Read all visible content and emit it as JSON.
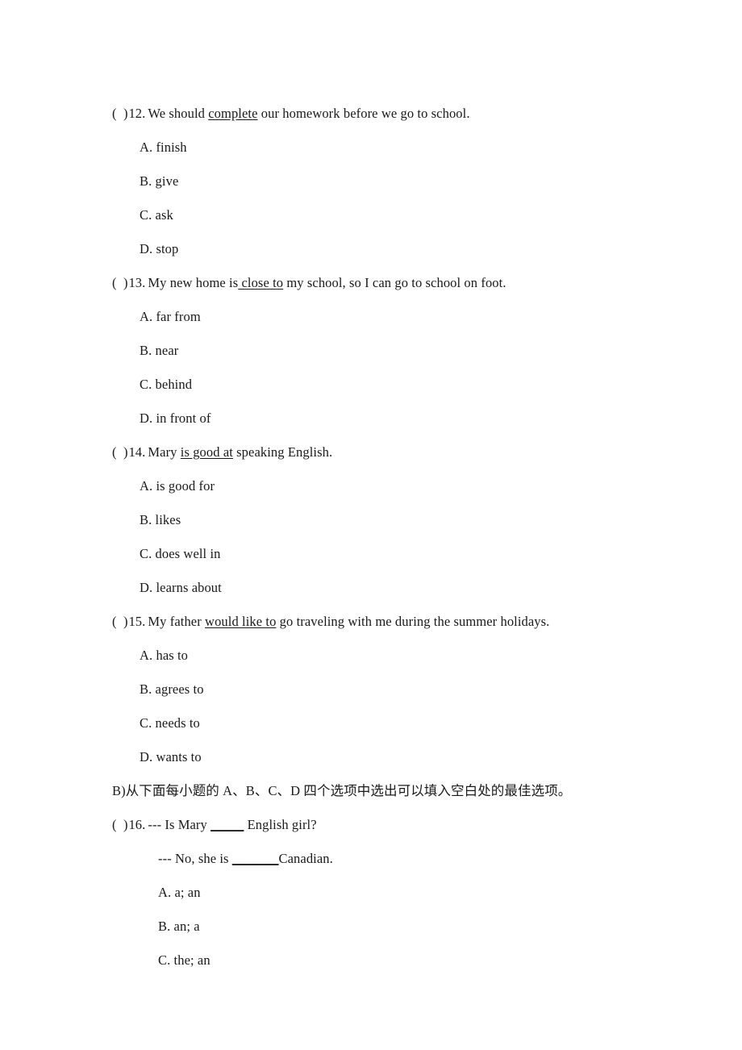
{
  "page": {
    "document_type": "english-exam-worksheet",
    "background_color": "#ffffff",
    "text_color": "#1a1a1a"
  },
  "questions": [
    {
      "marker": "(",
      "marker_close": ")",
      "number": "12.",
      "stem_before": "We should ",
      "stem_underlined": "complete",
      "stem_after": " our homework before we go to school.",
      "options": [
        "A. finish",
        "B. give",
        "C. ask",
        "D. stop"
      ]
    },
    {
      "marker": "(",
      "marker_close": ")",
      "number": "13.",
      "stem_before": "My new home is",
      "stem_underlined": " close to",
      "stem_after": " my school, so I can go to school on foot.",
      "options": [
        "A. far from",
        "B. near",
        "C. behind",
        "D. in front of"
      ]
    },
    {
      "marker": "(",
      "marker_close": ")",
      "number": "14.",
      "stem_before": "Mary ",
      "stem_underlined": "is good at",
      "stem_after": " speaking English.",
      "options": [
        "A. is good for",
        "B. likes",
        "C. does well in",
        "D. learns about"
      ]
    },
    {
      "marker": "(",
      "marker_close": ")",
      "number": "15.",
      "stem_before": "My father ",
      "stem_underlined": "would like to",
      "stem_after": " go traveling with me during the summer holidays.",
      "options": [
        "A. has to",
        "B. agrees to",
        "C. needs to",
        "D. wants to"
      ]
    }
  ],
  "section_b": {
    "instruction": "B)从下面每小题的 A、B、C、D 四个选项中选出可以填入空白处的最佳选项。",
    "question": {
      "marker": "(",
      "marker_close": ")",
      "number": "16.",
      "line1_before": "--- Is Mary ",
      "line1_blank": "_____",
      "line1_after": " English girl?",
      "line2_before": "--- No, she is ",
      "line2_blank": "_______",
      "line2_after": "Canadian.",
      "options": [
        "A. a; an",
        "B. an; a",
        "C. the; an"
      ]
    }
  }
}
